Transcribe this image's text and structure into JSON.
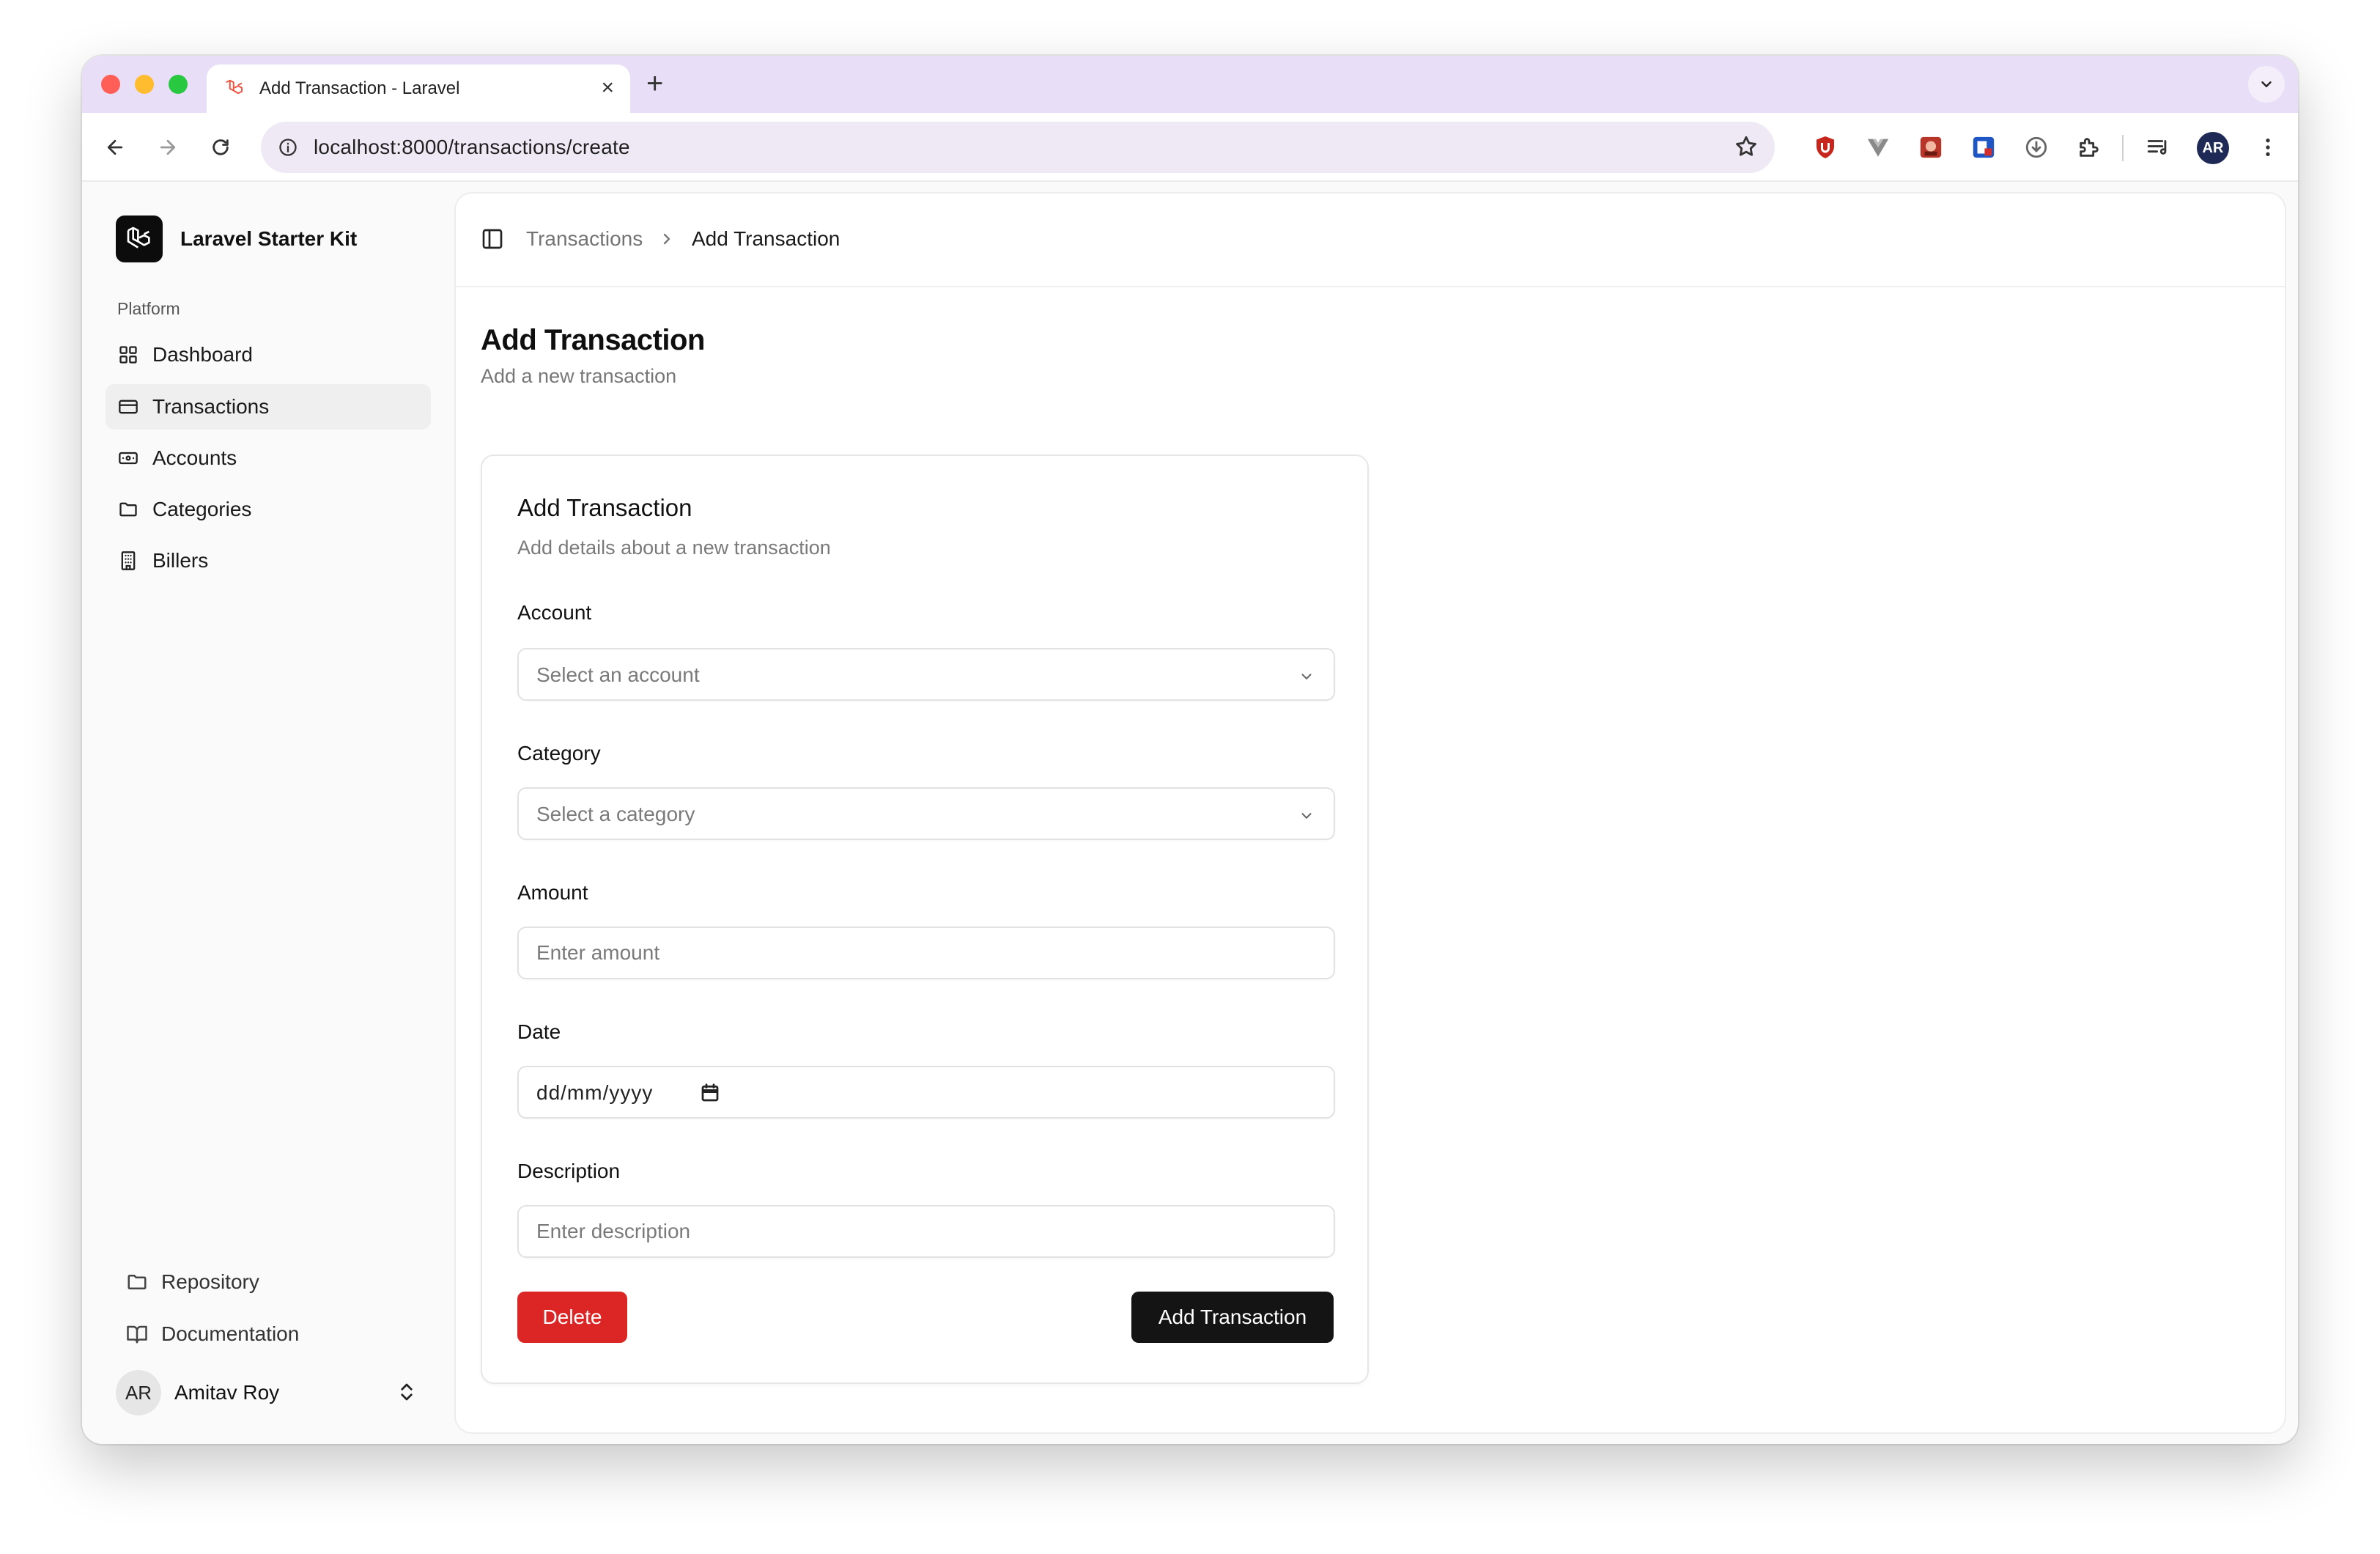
{
  "browser": {
    "tab_title": "Add Transaction - Laravel",
    "tab_close": "×",
    "new_tab": "+",
    "url": "localhost:8000/transactions/create",
    "profile_initials": "AR"
  },
  "sidebar": {
    "brand_name": "Laravel Starter Kit",
    "section_label": "Platform",
    "items": [
      {
        "label": "Dashboard",
        "icon": "grid-icon",
        "active": false
      },
      {
        "label": "Transactions",
        "icon": "credit-card-icon",
        "active": true
      },
      {
        "label": "Accounts",
        "icon": "banknote-icon",
        "active": false
      },
      {
        "label": "Categories",
        "icon": "folder-icon",
        "active": false
      },
      {
        "label": "Billers",
        "icon": "building-icon",
        "active": false
      }
    ],
    "footer_links": [
      {
        "label": "Repository",
        "icon": "folder-icon"
      },
      {
        "label": "Documentation",
        "icon": "book-open-icon"
      }
    ],
    "user": {
      "initials": "AR",
      "name": "Amitav Roy"
    }
  },
  "breadcrumb": {
    "parent": "Transactions",
    "current": "Add Transaction"
  },
  "page": {
    "title": "Add Transaction",
    "subtitle": "Add a new transaction"
  },
  "form": {
    "title": "Add Transaction",
    "description": "Add details about a new transaction",
    "account": {
      "label": "Account",
      "placeholder": "Select an account"
    },
    "category": {
      "label": "Category",
      "placeholder": "Select a category"
    },
    "amount": {
      "label": "Amount",
      "placeholder": "Enter amount"
    },
    "date": {
      "label": "Date",
      "placeholder": "dd/mm/yyyy"
    },
    "description_field": {
      "label": "Description",
      "placeholder": "Enter description"
    },
    "delete_label": "Delete",
    "submit_label": "Add Transaction"
  },
  "colors": {
    "tabbar": "#e9def7",
    "delete": "#dc2626",
    "primary": "#141414"
  }
}
